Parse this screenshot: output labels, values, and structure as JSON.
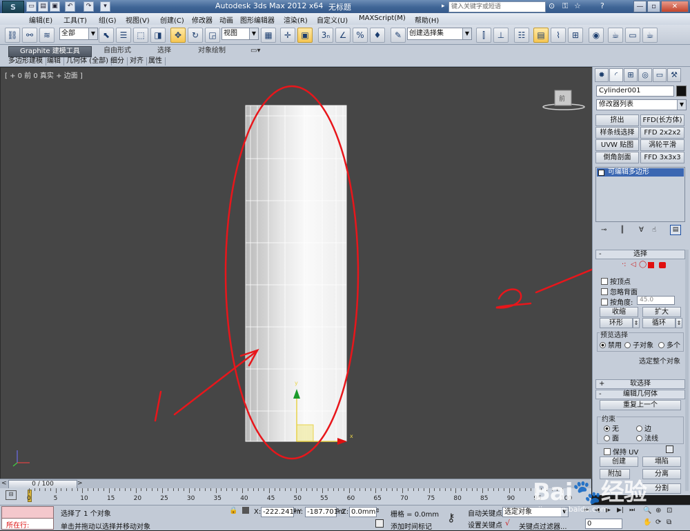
{
  "window": {
    "title": "Autodesk 3ds Max  2012 x64",
    "doc_title": "无标题",
    "search_placeholder": "键入关键字或短语",
    "buttons": [
      "—",
      "▫",
      "✕"
    ]
  },
  "menu": [
    "编辑(E)",
    "工具(T)",
    "组(G)",
    "视图(V)",
    "创建(C)",
    "修改器",
    "动画",
    "图形编辑器",
    "渲染(R)",
    "自定义(U)",
    "MAXScript(M)",
    "帮助(H)"
  ],
  "toolbar": {
    "selection_filter": "全部",
    "ref_coord": "视图",
    "named_selection": "创建选择集"
  },
  "ribbon": {
    "tabs": [
      "Graphite 建模工具",
      "自由形式",
      "选择",
      "对象绘制"
    ],
    "subtabs": [
      "多边形建模",
      "编辑",
      "几何体 (全部)",
      "细分",
      "对齐",
      "属性"
    ]
  },
  "viewport": {
    "label": "[ + 0 前 0 真实 + 边面 ]",
    "viewcube_label": "前",
    "annotation_1": "1",
    "annotation_2": "2"
  },
  "command_panel": {
    "object_name": "Cylinder001",
    "modifier_list": "修改器列表",
    "modifier_buttons": [
      "挤出",
      "FFD(长方体)",
      "样条线选择",
      "FFD 2x2x2",
      "UVW 贴图",
      "涡轮平滑",
      "倒角剖面",
      "FFD 3x3x3"
    ],
    "stack_item": "可编辑多边形",
    "selection_rollout": {
      "title": "选择",
      "by_vertex": "按顶点",
      "ignore_backfacing": "忽略背面",
      "by_angle": "按角度:",
      "angle_value": "45.0",
      "shrink": "收缩",
      "grow": "扩大",
      "ring": "环形",
      "loop": "循环",
      "preview_title": "预览选择",
      "preview_options": [
        "禁用",
        "子对象",
        "多个"
      ],
      "whole_object": "选定整个对象"
    },
    "soft_selection_title": "软选择",
    "edit_geometry": {
      "title": "编辑几何体",
      "repeat_last": "重复上一个",
      "constraints_title": "约束",
      "constraints": [
        "无",
        "边",
        "面",
        "法线"
      ],
      "preserve_uv": "保持 UV",
      "create": "创建",
      "collapse": "塌陷",
      "attach": "附加",
      "detach": "分离",
      "slice": "分割"
    }
  },
  "timeline": {
    "frame_counter": "0 / 100",
    "ticks": [
      "0",
      "5",
      "10",
      "15",
      "20",
      "25",
      "30",
      "35",
      "40",
      "45",
      "50",
      "55",
      "60",
      "65",
      "70",
      "75",
      "80",
      "85",
      "90",
      "95",
      "100"
    ]
  },
  "status": {
    "running": "所在行:",
    "selected_msg": "选择了 1 个对象",
    "prompt": "单击并拖动以选择并移动对象",
    "x_label": "X:",
    "x_value": "-222.241m",
    "y_label": "Y:",
    "y_value": "-187.701m",
    "z_label": "Z:",
    "z_value": "0.0mm",
    "grid": "栅格 = 0.0mm",
    "auto_key": "自动关键点",
    "set_key": "设置关键点",
    "selected_set": "选定对象",
    "key_filters": "关键点过滤器...",
    "add_time_tag": "添加时间标记",
    "frame_field": "0"
  },
  "watermark": "jingyan.baidu.com",
  "colors": {
    "viewport_bg": "#464646",
    "annotation_red": "#e8161b",
    "accent_blue": "#3b67b2"
  }
}
